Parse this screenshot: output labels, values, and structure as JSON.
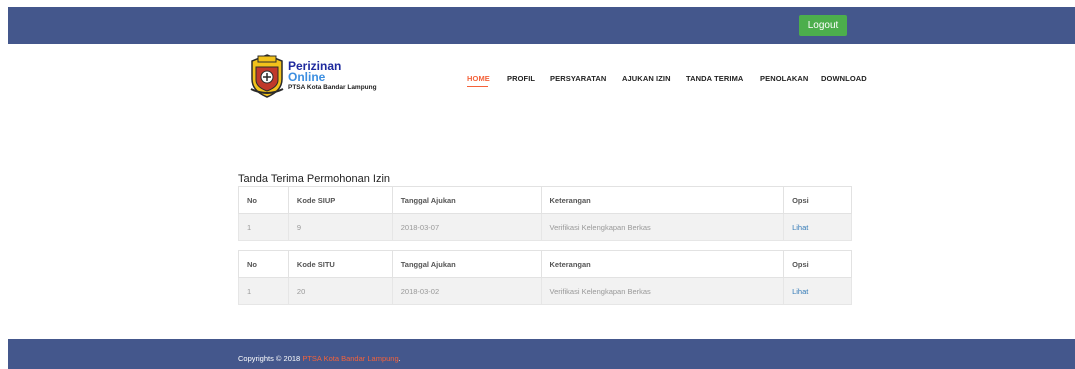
{
  "topbar": {
    "logout_label": "Logout"
  },
  "brand": {
    "line1": "Perizinan",
    "line2": "Online",
    "line3": "PTSA Kota Bandar Lampung"
  },
  "nav": {
    "items": [
      {
        "label": "HOME",
        "active": true
      },
      {
        "label": "PROFIL",
        "active": false
      },
      {
        "label": "PERSYARATAN",
        "active": false
      },
      {
        "label": "AJUKAN IZIN",
        "active": false
      },
      {
        "label": "TANDA TERIMA",
        "active": false
      },
      {
        "label": "PENOLAKAN",
        "active": false
      },
      {
        "label": "DOWNLOAD",
        "active": false
      }
    ]
  },
  "main": {
    "title": "Tanda Terima Permohonan Izin",
    "siup_table": {
      "headers": [
        "No",
        "Kode SIUP",
        "Tanggal Ajukan",
        "Keterangan",
        "Opsi"
      ],
      "rows": [
        {
          "no": "1",
          "kode": "9",
          "tanggal": "2018-03-07",
          "keterangan": "Verifikasi Kelengkapan Berkas",
          "opsi": "Lihat"
        }
      ]
    },
    "situ_table": {
      "headers": [
        "No",
        "Kode SITU",
        "Tanggal Ajukan",
        "Keterangan",
        "Opsi"
      ],
      "rows": [
        {
          "no": "1",
          "kode": "20",
          "tanggal": "2018-03-02",
          "keterangan": "Verifikasi Kelengkapan Berkas",
          "opsi": "Lihat"
        }
      ]
    }
  },
  "footer": {
    "prefix": "Copyrights © 2018 ",
    "link": "PTSA Kota Bandar Lampung",
    "suffix": "."
  },
  "colors": {
    "bar": "#44578c",
    "accent": "#f4623a",
    "logout": "#4cae4c",
    "link": "#337ab7"
  }
}
